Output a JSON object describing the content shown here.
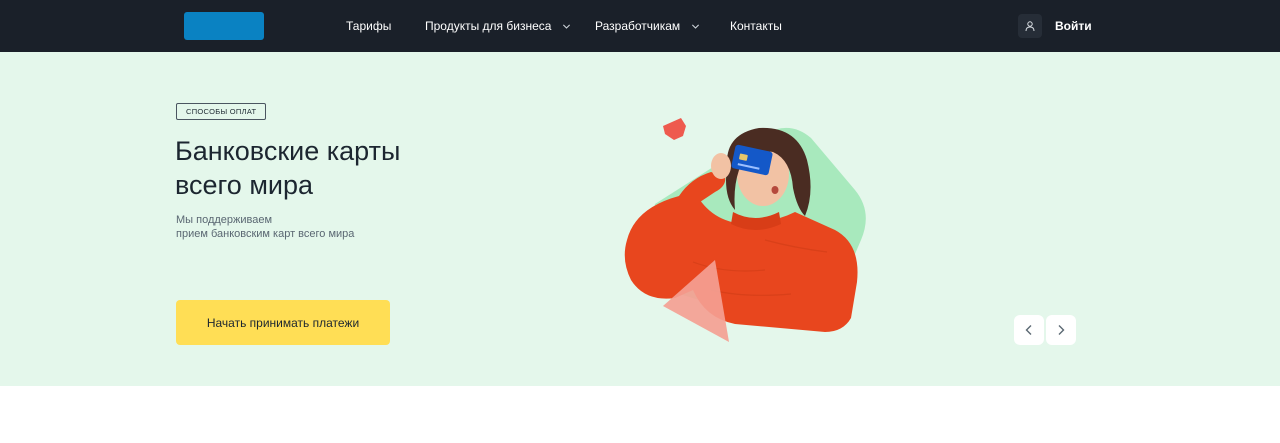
{
  "header": {
    "nav": [
      {
        "label": "Тарифы",
        "has_dropdown": false
      },
      {
        "label": "Продукты для бизнеса",
        "has_dropdown": true
      },
      {
        "label": "Разработчикам",
        "has_dropdown": true
      },
      {
        "label": "Контакты",
        "has_dropdown": false
      }
    ],
    "login_label": "Войти",
    "colors": {
      "background": "#1a2029",
      "logo": "#0a82c2"
    }
  },
  "hero": {
    "badge": "способы оплат",
    "title_line1": "Банковские карты",
    "title_line2": "всего мира",
    "subtitle_line1": "Мы поддерживаем",
    "subtitle_line2": "прием банковским карт всего мира",
    "cta_label": "Начать принимать платежи",
    "colors": {
      "background": "#e4f7eb",
      "cta": "#ffde55",
      "sweater": "#e8461e",
      "accent_red": "#ee5a4e",
      "accent_green": "#a8e9bd"
    }
  },
  "icons": {
    "user": "user-icon",
    "chevron_down": "chevron-down-icon",
    "prev": "chevron-left-icon",
    "next": "chevron-right-icon"
  }
}
